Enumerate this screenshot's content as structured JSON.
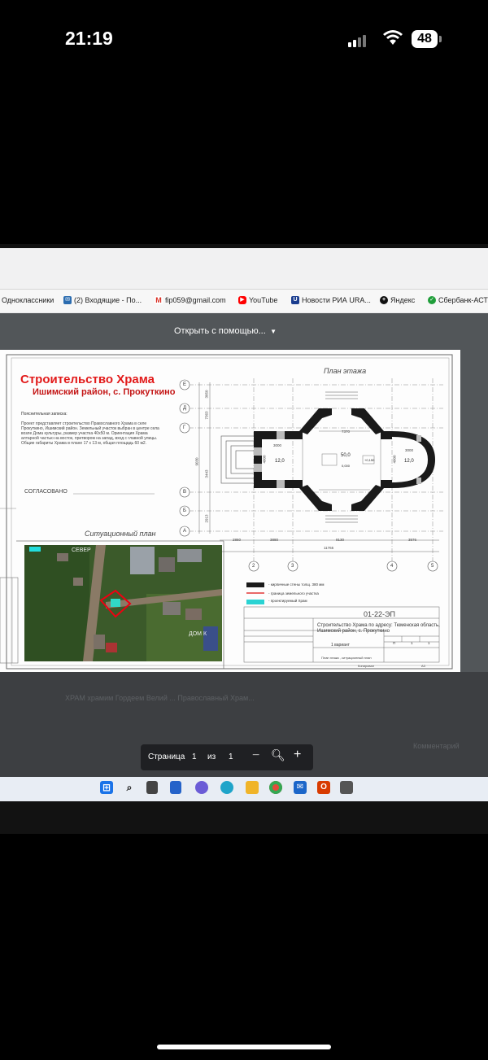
{
  "status_bar": {
    "time": "21:19",
    "battery": "48"
  },
  "bookmarks": [
    {
      "label": "Одноклассники",
      "icon": "odnoklassniki-icon",
      "color": "#f7931e"
    },
    {
      "label": "(2) Входящие - По...",
      "icon": "mail-icon",
      "color": "#2b6cb0"
    },
    {
      "label": "fip059@gmail.com",
      "icon": "gmail-icon",
      "color": "#d93025"
    },
    {
      "label": "YouTube",
      "icon": "youtube-icon",
      "color": "#ff0000"
    },
    {
      "label": "Новости РИА URA...",
      "icon": "ura-news-icon",
      "color": "#1a3d8f"
    },
    {
      "label": "Яндекс",
      "icon": "yandex-icon",
      "color": "#111111"
    },
    {
      "label": "Сбербанк-АСТ",
      "icon": "sberbank-icon",
      "color": "#1f9e3a"
    }
  ],
  "viewer": {
    "open_with": "Открыть с помощью...",
    "page_label": "Страница",
    "page_current": "1",
    "page_of": "из",
    "page_total": "1"
  },
  "drawing": {
    "title": "Строительство  Храма",
    "subtitle": "Ишимский район, с. Прокуткино",
    "note_heading": "Пояснительная записка:",
    "note_text": "Проект представляет строительство Православного Храма в селе Прокуткино, Ишимский район. Земельный участок выбран в центре села возле Дома культуры, размер участка 40х50 м. Ориентация Храма алтарной частью на восток, притвором на запад, вход с главной улицы. Общие габариты Храма в плане 17 х 13 м, общая площадь 60 м2.",
    "agreed_label": "СОГЛАСОВАНО",
    "plan_title": "План этажа",
    "site_plan_title": "Ситуационный план",
    "map_north": "СЕВЕР",
    "map_dk": "ДОМ К",
    "axes_letters": [
      "Е",
      "Д",
      "Г",
      "В",
      "Б",
      "А"
    ],
    "axes_numbers": [
      "2",
      "3",
      "4",
      "5"
    ],
    "dims_bottom": [
      "2860",
      "3880",
      "9130",
      "3976"
    ],
    "dim_total": "11765",
    "dims_left": [
      "3050",
      "7363",
      "9030",
      "3443",
      "2913"
    ],
    "room_areas": [
      "12,0",
      "50,0",
      "12,0"
    ],
    "room_dims": [
      "7370",
      "3000",
      "3000",
      "4000",
      "4000"
    ],
    "levels": [
      "0,000",
      "+0,150"
    ],
    "legend": [
      "- кирпичные стены толщ. 380 мм",
      "- граница земельного участка",
      "- проектируемый Храм"
    ],
    "doc_code": "01-22-ЭП",
    "address": "Строительство  Храма  по адресу: Тюменская область, Ишимский район, с. Прокуткино",
    "stage": "П",
    "sheet": "1",
    "sheets": "1",
    "sheet_name": "План этажа , ситуационный план",
    "variant": "1 вариант",
    "format": "А3",
    "copied": "Копировал",
    "colors": {
      "title_red": "#e21a1a",
      "legend_red": "#d11",
      "legend_cyan": "#2ad3d3"
    }
  },
  "background_text": [
    "ХРАМ храмим Гордеем Велий ... Православный Храм...",
    "Комментарий"
  ],
  "taskbar_icons": [
    "windows-start-icon",
    "search-icon",
    "task-view-icon",
    "widgets-icon",
    "teams-chat-icon",
    "edge-icon",
    "file-explorer-icon",
    "chrome-icon",
    "mail-icon",
    "office-icon",
    "scanner-icon"
  ]
}
